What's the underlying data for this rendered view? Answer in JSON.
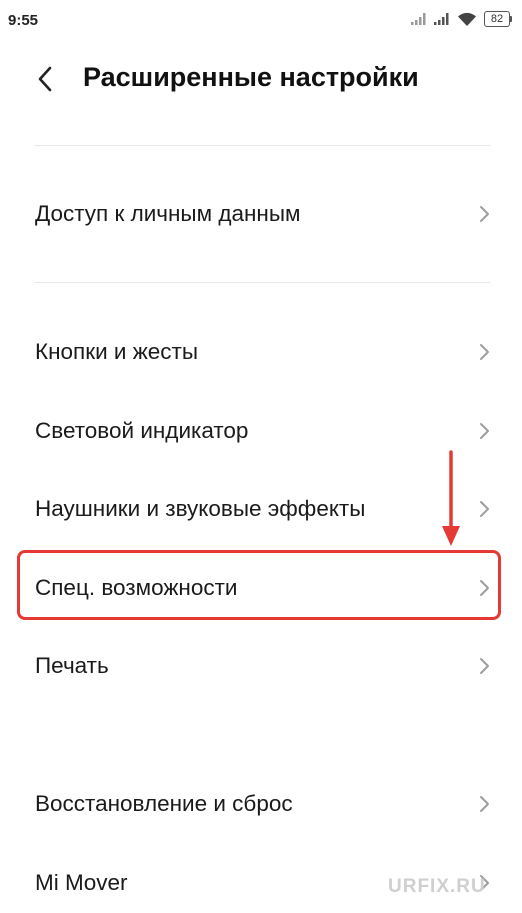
{
  "status_bar": {
    "time": "9:55",
    "battery": "82",
    "icons": [
      "signal-icon",
      "signal-icon",
      "wifi-icon",
      "battery-icon"
    ]
  },
  "header": {
    "back_icon": "chevron-left-icon",
    "title": "Расширенные настройки"
  },
  "menu": {
    "items": [
      {
        "label": "Доступ к личным данным",
        "icon": "chevron-right-icon"
      },
      {
        "label": "Кнопки и жесты",
        "icon": "chevron-right-icon"
      },
      {
        "label": "Световой индикатор",
        "icon": "chevron-right-icon"
      },
      {
        "label": "Наушники и звуковые эффекты",
        "icon": "chevron-right-icon"
      },
      {
        "label": "Спец. возможности",
        "icon": "chevron-right-icon",
        "highlighted": true
      },
      {
        "label": "Печать",
        "icon": "chevron-right-icon"
      },
      {
        "label": "Восстановление и сброс",
        "icon": "chevron-right-icon"
      },
      {
        "label": "Mi Mover",
        "icon": "chevron-right-icon"
      }
    ]
  },
  "annotation": {
    "highlight_color": "#e53935",
    "arrow_icon": "arrow-down-icon"
  },
  "watermark": "URFIX.RU",
  "colors": {
    "background": "#ffffff",
    "text": "#111111",
    "divider": "#e6e6e6",
    "chevron": "#9e9e9e"
  }
}
